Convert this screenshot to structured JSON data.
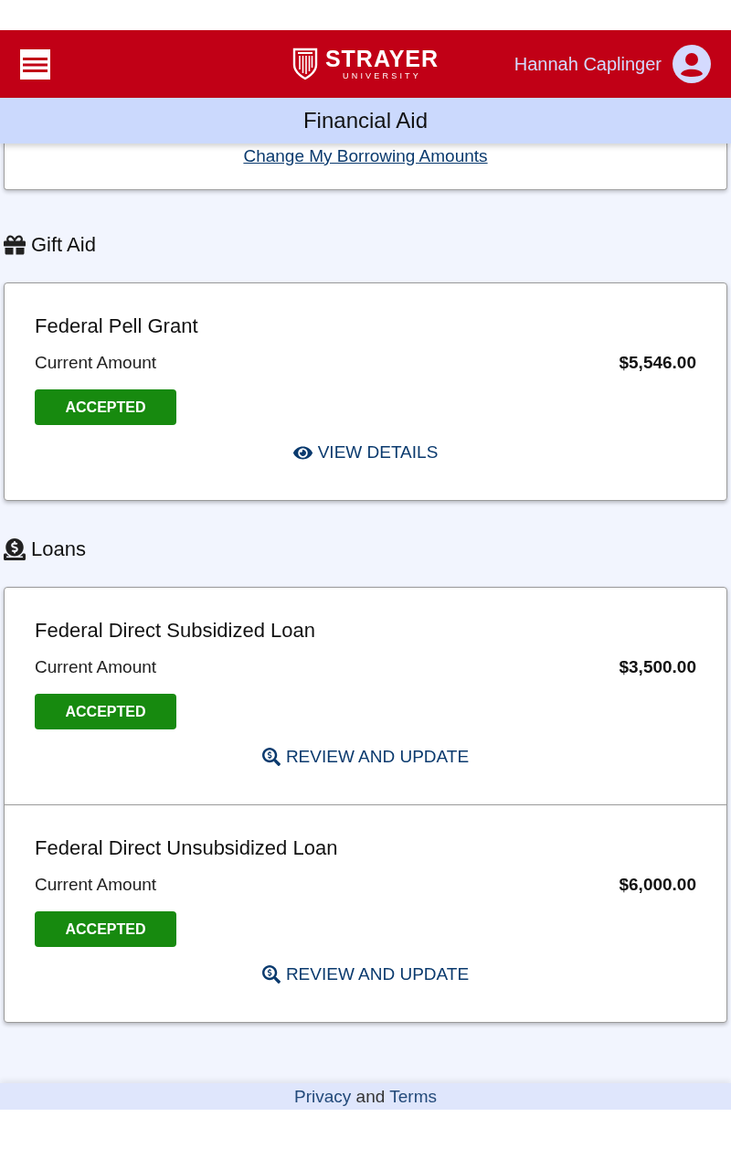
{
  "header": {
    "logo": {
      "name": "STRAYER",
      "tagline": "UNIVERSITY"
    },
    "user": {
      "name": "Hannah Caplinger"
    }
  },
  "page_title": "Financial Aid",
  "top_card": {
    "link": "Change My Borrowing Amounts"
  },
  "sections": [
    {
      "kind": "gift",
      "heading": "Gift Aid",
      "items": [
        {
          "title": "Federal Pell Grant",
          "amount_label": "Current Amount",
          "amount": "$5,546.00",
          "status": "ACCEPTED",
          "action": {
            "kind": "view",
            "label": "VIEW DETAILS"
          }
        }
      ]
    },
    {
      "kind": "loans",
      "heading": "Loans",
      "items": [
        {
          "title": "Federal Direct Subsidized Loan",
          "amount_label": "Current Amount",
          "amount": "$3,500.00",
          "status": "ACCEPTED",
          "action": {
            "kind": "review",
            "label": "REVIEW AND UPDATE"
          }
        },
        {
          "title": "Federal Direct Unsubsidized Loan",
          "amount_label": "Current Amount",
          "amount": "$6,000.00",
          "status": "ACCEPTED",
          "action": {
            "kind": "review",
            "label": "REVIEW AND UPDATE"
          }
        }
      ]
    }
  ],
  "footer": {
    "privacy_link": "Privacy",
    "connector": "and",
    "terms_link": "Terms"
  }
}
